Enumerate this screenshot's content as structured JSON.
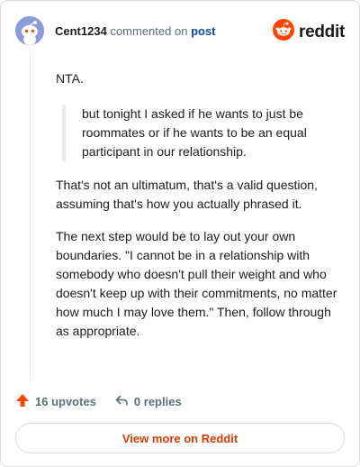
{
  "header": {
    "username": "Cent1234",
    "action_text": "commented on",
    "post_link": "post",
    "brand": "reddit"
  },
  "comment": {
    "paragraph1": "NTA.",
    "quote": "but tonight I asked if he wants to just be roommates or if he wants to be an equal participant in our relationship.",
    "paragraph2": "That's not an ultimatum, that's a valid question, assuming that's how you actually phrased it.",
    "paragraph3": "The next step would be to lay out your own boundaries. \"I cannot be in a relationship with somebody who doesn't pull their weight and who doesn't keep up with their commitments, no matter how much I may love them.\" Then, follow through as appropriate."
  },
  "actions": {
    "upvotes": "16 upvotes",
    "replies": "0 replies"
  },
  "footer": {
    "view_more": "View more on Reddit"
  },
  "colors": {
    "brand_orange": "#ff4500",
    "link_blue": "#0a4da8",
    "view_more_text": "#d93a00"
  },
  "icons": {
    "avatar": "snoo-avatar-icon",
    "brand": "reddit-logo-icon",
    "upvote": "upvote-arrow-icon",
    "reply": "reply-arrow-icon"
  }
}
